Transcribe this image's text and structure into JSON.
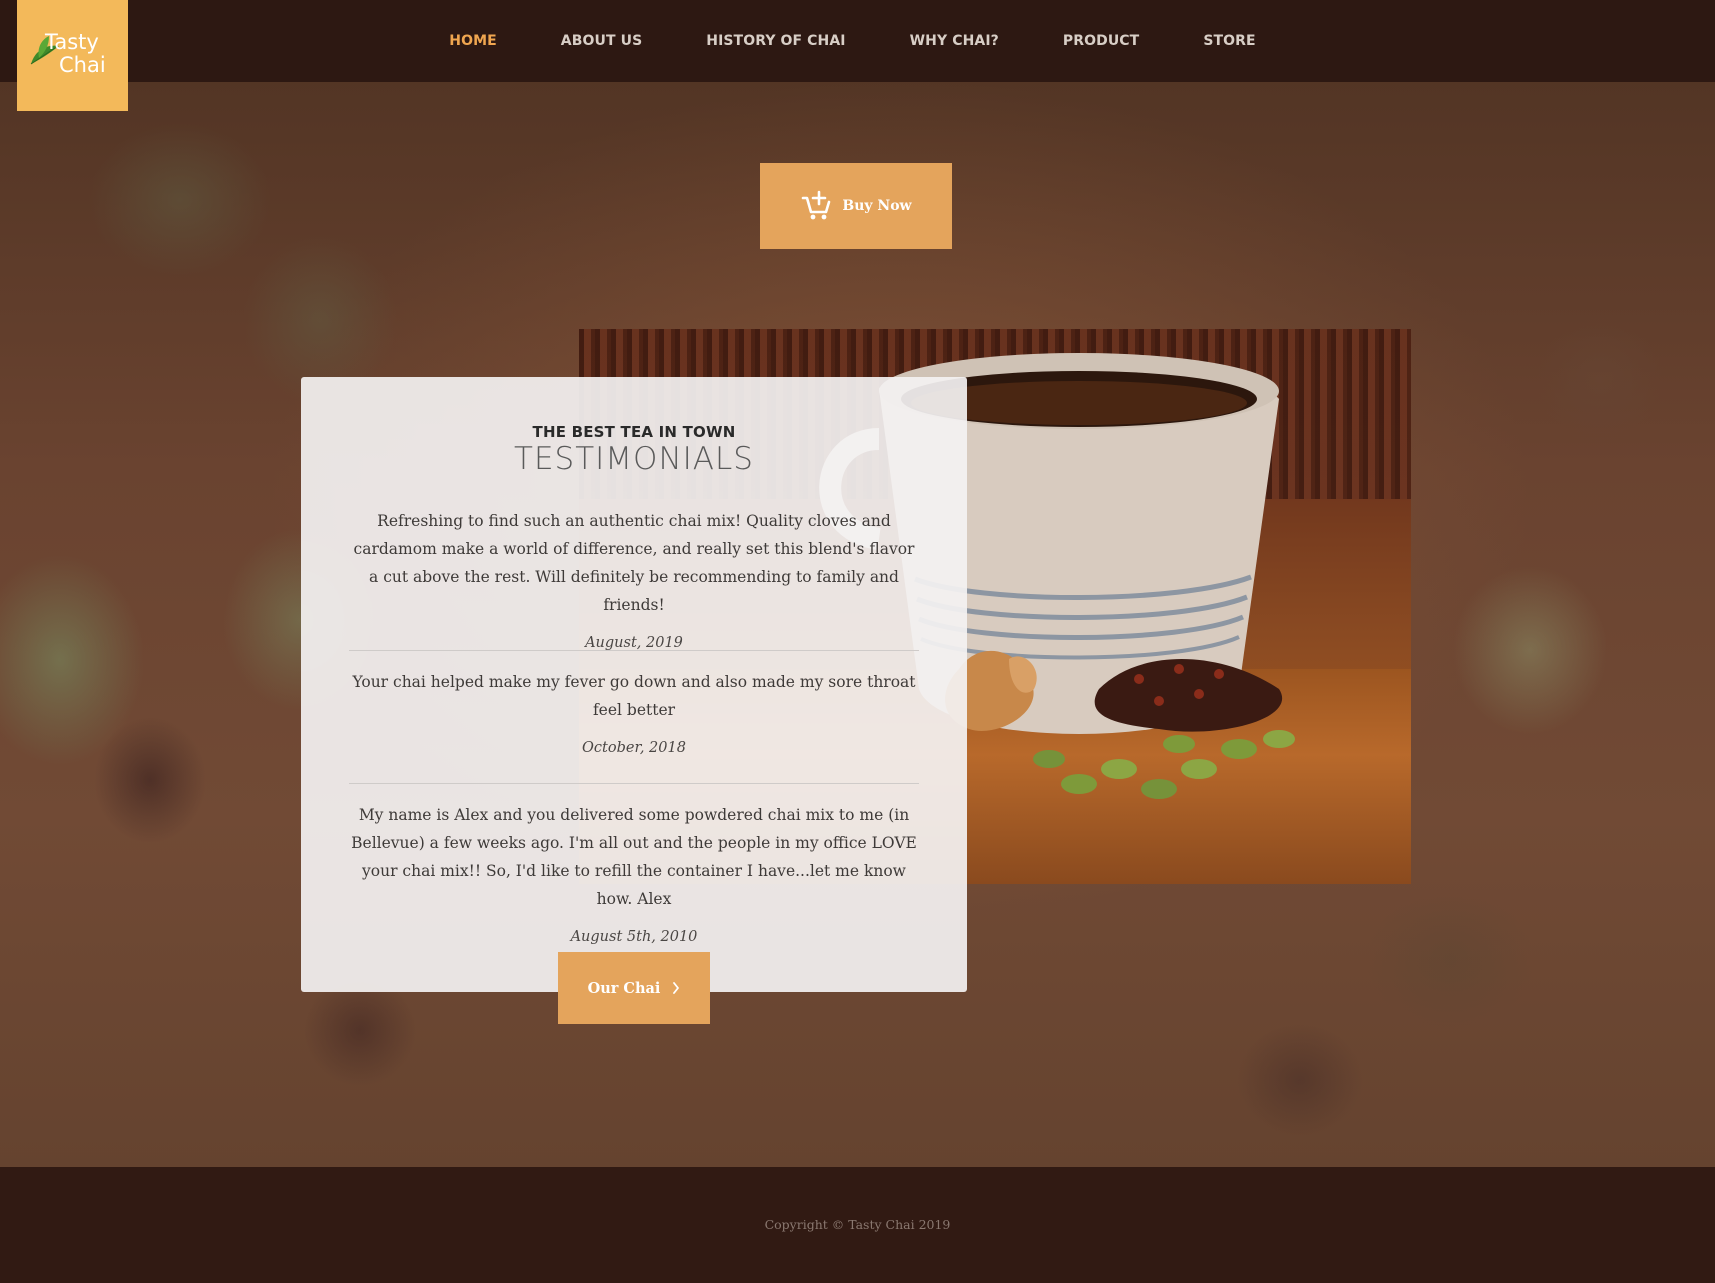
{
  "brand": {
    "logo_line1": "Tasty",
    "logo_line2": "Chai",
    "accent_color": "#f3b95a",
    "button_color": "#e4a45c",
    "nav_active_color": "#f0a650"
  },
  "nav": {
    "items": [
      {
        "label": "HOME",
        "active": true
      },
      {
        "label": "ABOUT US",
        "active": false
      },
      {
        "label": "HISTORY OF CHAI",
        "active": false
      },
      {
        "label": "WHY CHAI?",
        "active": false
      },
      {
        "label": "PRODUCT",
        "active": false
      },
      {
        "label": "STORE",
        "active": false
      }
    ]
  },
  "hero": {
    "buy_button_label": "Buy Now",
    "buy_button_icon": "cart-plus-icon"
  },
  "testimonials": {
    "eyebrow": "THE BEST TEA IN TOWN",
    "title": "TESTIMONIALS",
    "items": [
      {
        "quote": "Refreshing to find such an authentic chai mix! Quality cloves and cardamom make a world of difference, and really set this blend's flavor a cut above the rest. Will definitely be recommending to family and friends!",
        "date": "August, 2019"
      },
      {
        "quote": "Your chai helped make my fever go down and also made my sore throat feel better",
        "date": "October, 2018"
      },
      {
        "quote": "My name is Alex and you delivered some powdered chai mix to me (in Bellevue) a few weeks ago. I'm all out and the people in my office LOVE your chai mix!! So, I'd like to refill the container I have...let me know how. Alex",
        "date": "August 5th, 2010"
      }
    ],
    "cta_label": "Our Chai",
    "cta_icon": "chevron-right-icon"
  },
  "footer": {
    "copyright": "Copyright © Tasty Chai 2019"
  }
}
